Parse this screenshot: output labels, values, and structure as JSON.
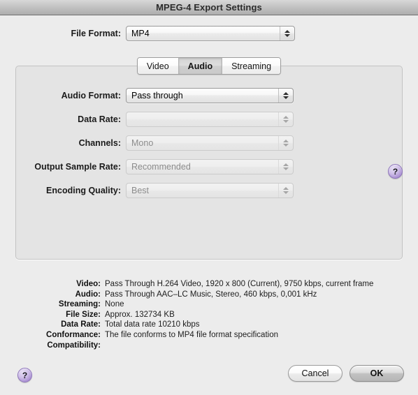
{
  "window": {
    "title": "MPEG-4 Export Settings"
  },
  "file_format": {
    "label": "File Format:",
    "value": "MP4"
  },
  "tabs": [
    {
      "label": "Video",
      "selected": false
    },
    {
      "label": "Audio",
      "selected": true
    },
    {
      "label": "Streaming",
      "selected": false
    }
  ],
  "fields": [
    {
      "label": "Audio Format:",
      "value": "Pass through",
      "enabled": true
    },
    {
      "label": "Data Rate:",
      "value": "",
      "enabled": false
    },
    {
      "label": "Channels:",
      "value": "Mono",
      "enabled": false
    },
    {
      "label": "Output Sample Rate:",
      "value": "Recommended",
      "enabled": false
    },
    {
      "label": "Encoding Quality:",
      "value": "Best",
      "enabled": false
    }
  ],
  "help": {
    "panel_label": "?",
    "bottom_label": "?"
  },
  "summary": [
    {
      "key": "Video:",
      "value": "Pass Through H.264 Video, 1920 x 800 (Current), 9750 kbps, current frame"
    },
    {
      "key": "Audio:",
      "value": "Pass Through AAC–LC Music, Stereo, 460 kbps, 0,001 kHz"
    },
    {
      "key": "Streaming:",
      "value": "None"
    },
    {
      "key": "File Size:",
      "value": "Approx. 132734 KB"
    },
    {
      "key": "Data Rate:",
      "value": "Total data rate 10210 kbps"
    },
    {
      "key": "Conformance:",
      "value": "The file conforms to MP4 file format specification"
    },
    {
      "key": "Compatibility:",
      "value": ""
    }
  ],
  "buttons": {
    "cancel": "Cancel",
    "ok": "OK"
  },
  "colors": {
    "window_bg": "#ececec",
    "groupbox_bg": "#e4e4e4",
    "help_purple": "#a98ed2",
    "disabled_text": "#8c8c8c"
  }
}
